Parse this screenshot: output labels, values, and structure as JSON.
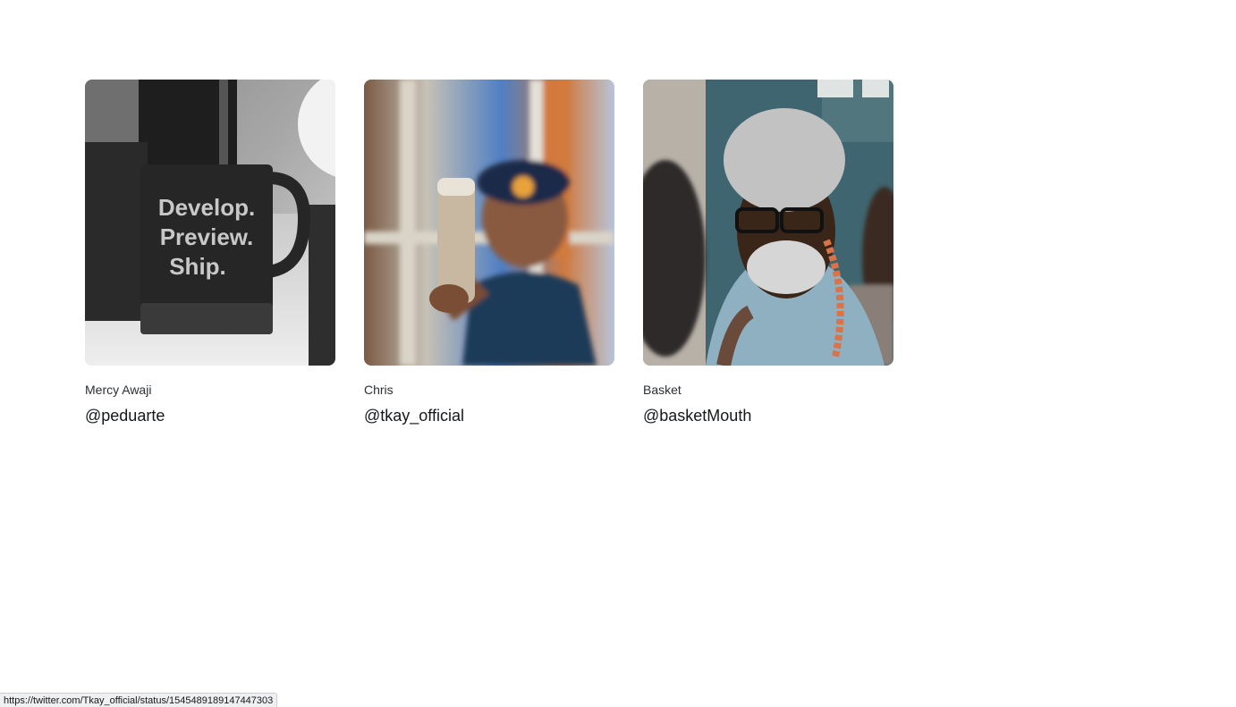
{
  "cards": [
    {
      "name": "Mercy Awaji",
      "handle": "@peduarte",
      "image": "mug-photo",
      "mug_text": [
        "Develop.",
        "Preview.",
        "Ship."
      ]
    },
    {
      "name": "Chris",
      "handle": "@tkay_official",
      "image": "woman-with-wrap-photo"
    },
    {
      "name": "Basket",
      "handle": "@basketMouth",
      "image": "elderly-man-photo"
    }
  ],
  "status_bar": {
    "url": "https://twitter.com/Tkay_official/status/1545489189147447303"
  }
}
